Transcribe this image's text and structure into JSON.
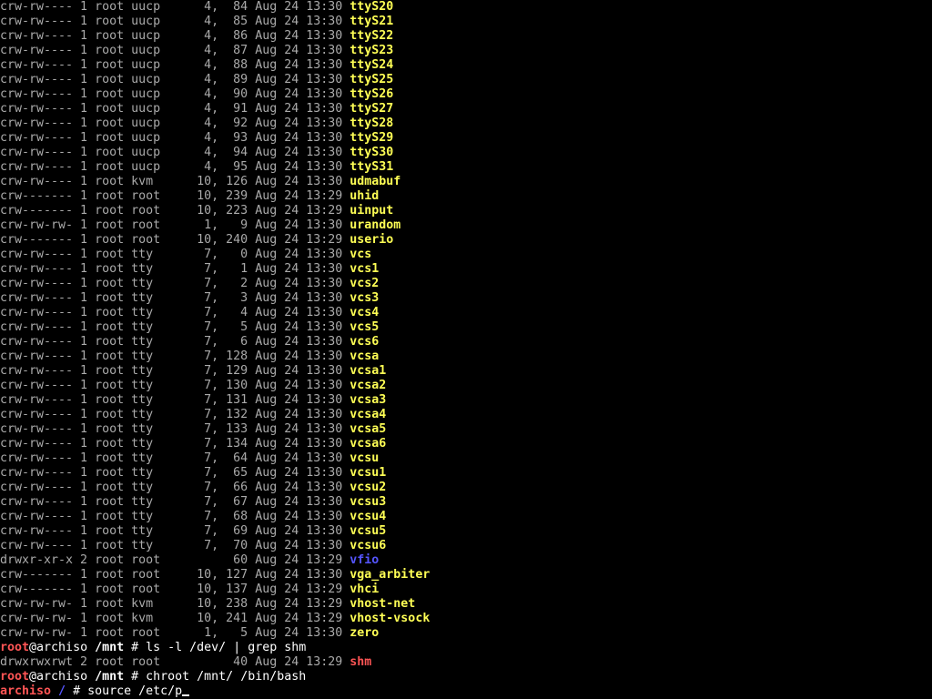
{
  "terminal": {
    "listing": [
      {
        "meta": "crw-rw---- 1 root uucp      4,  84 Aug 24 13:30 ",
        "name": "ttyS20",
        "kind": "dev"
      },
      {
        "meta": "crw-rw---- 1 root uucp      4,  85 Aug 24 13:30 ",
        "name": "ttyS21",
        "kind": "dev"
      },
      {
        "meta": "crw-rw---- 1 root uucp      4,  86 Aug 24 13:30 ",
        "name": "ttyS22",
        "kind": "dev"
      },
      {
        "meta": "crw-rw---- 1 root uucp      4,  87 Aug 24 13:30 ",
        "name": "ttyS23",
        "kind": "dev"
      },
      {
        "meta": "crw-rw---- 1 root uucp      4,  88 Aug 24 13:30 ",
        "name": "ttyS24",
        "kind": "dev"
      },
      {
        "meta": "crw-rw---- 1 root uucp      4,  89 Aug 24 13:30 ",
        "name": "ttyS25",
        "kind": "dev"
      },
      {
        "meta": "crw-rw---- 1 root uucp      4,  90 Aug 24 13:30 ",
        "name": "ttyS26",
        "kind": "dev"
      },
      {
        "meta": "crw-rw---- 1 root uucp      4,  91 Aug 24 13:30 ",
        "name": "ttyS27",
        "kind": "dev"
      },
      {
        "meta": "crw-rw---- 1 root uucp      4,  92 Aug 24 13:30 ",
        "name": "ttyS28",
        "kind": "dev"
      },
      {
        "meta": "crw-rw---- 1 root uucp      4,  93 Aug 24 13:30 ",
        "name": "ttyS29",
        "kind": "dev"
      },
      {
        "meta": "crw-rw---- 1 root uucp      4,  94 Aug 24 13:30 ",
        "name": "ttyS30",
        "kind": "dev"
      },
      {
        "meta": "crw-rw---- 1 root uucp      4,  95 Aug 24 13:30 ",
        "name": "ttyS31",
        "kind": "dev"
      },
      {
        "meta": "crw-rw---- 1 root kvm      10, 126 Aug 24 13:30 ",
        "name": "udmabuf",
        "kind": "dev"
      },
      {
        "meta": "crw------- 1 root root     10, 239 Aug 24 13:29 ",
        "name": "uhid",
        "kind": "dev"
      },
      {
        "meta": "crw------- 1 root root     10, 223 Aug 24 13:29 ",
        "name": "uinput",
        "kind": "dev"
      },
      {
        "meta": "crw-rw-rw- 1 root root      1,   9 Aug 24 13:30 ",
        "name": "urandom",
        "kind": "dev"
      },
      {
        "meta": "crw------- 1 root root     10, 240 Aug 24 13:29 ",
        "name": "userio",
        "kind": "dev"
      },
      {
        "meta": "crw-rw---- 1 root tty       7,   0 Aug 24 13:30 ",
        "name": "vcs",
        "kind": "dev"
      },
      {
        "meta": "crw-rw---- 1 root tty       7,   1 Aug 24 13:30 ",
        "name": "vcs1",
        "kind": "dev"
      },
      {
        "meta": "crw-rw---- 1 root tty       7,   2 Aug 24 13:30 ",
        "name": "vcs2",
        "kind": "dev"
      },
      {
        "meta": "crw-rw---- 1 root tty       7,   3 Aug 24 13:30 ",
        "name": "vcs3",
        "kind": "dev"
      },
      {
        "meta": "crw-rw---- 1 root tty       7,   4 Aug 24 13:30 ",
        "name": "vcs4",
        "kind": "dev"
      },
      {
        "meta": "crw-rw---- 1 root tty       7,   5 Aug 24 13:30 ",
        "name": "vcs5",
        "kind": "dev"
      },
      {
        "meta": "crw-rw---- 1 root tty       7,   6 Aug 24 13:30 ",
        "name": "vcs6",
        "kind": "dev"
      },
      {
        "meta": "crw-rw---- 1 root tty       7, 128 Aug 24 13:30 ",
        "name": "vcsa",
        "kind": "dev"
      },
      {
        "meta": "crw-rw---- 1 root tty       7, 129 Aug 24 13:30 ",
        "name": "vcsa1",
        "kind": "dev"
      },
      {
        "meta": "crw-rw---- 1 root tty       7, 130 Aug 24 13:30 ",
        "name": "vcsa2",
        "kind": "dev"
      },
      {
        "meta": "crw-rw---- 1 root tty       7, 131 Aug 24 13:30 ",
        "name": "vcsa3",
        "kind": "dev"
      },
      {
        "meta": "crw-rw---- 1 root tty       7, 132 Aug 24 13:30 ",
        "name": "vcsa4",
        "kind": "dev"
      },
      {
        "meta": "crw-rw---- 1 root tty       7, 133 Aug 24 13:30 ",
        "name": "vcsa5",
        "kind": "dev"
      },
      {
        "meta": "crw-rw---- 1 root tty       7, 134 Aug 24 13:30 ",
        "name": "vcsa6",
        "kind": "dev"
      },
      {
        "meta": "crw-rw---- 1 root tty       7,  64 Aug 24 13:30 ",
        "name": "vcsu",
        "kind": "dev"
      },
      {
        "meta": "crw-rw---- 1 root tty       7,  65 Aug 24 13:30 ",
        "name": "vcsu1",
        "kind": "dev"
      },
      {
        "meta": "crw-rw---- 1 root tty       7,  66 Aug 24 13:30 ",
        "name": "vcsu2",
        "kind": "dev"
      },
      {
        "meta": "crw-rw---- 1 root tty       7,  67 Aug 24 13:30 ",
        "name": "vcsu3",
        "kind": "dev"
      },
      {
        "meta": "crw-rw---- 1 root tty       7,  68 Aug 24 13:30 ",
        "name": "vcsu4",
        "kind": "dev"
      },
      {
        "meta": "crw-rw---- 1 root tty       7,  69 Aug 24 13:30 ",
        "name": "vcsu5",
        "kind": "dev"
      },
      {
        "meta": "crw-rw---- 1 root tty       7,  70 Aug 24 13:30 ",
        "name": "vcsu6",
        "kind": "dev"
      },
      {
        "meta": "drwxr-xr-x 2 root root          60 Aug 24 13:29 ",
        "name": "vfio",
        "kind": "dir"
      },
      {
        "meta": "crw------- 1 root root     10, 127 Aug 24 13:30 ",
        "name": "vga_arbiter",
        "kind": "dev"
      },
      {
        "meta": "crw------- 1 root root     10, 137 Aug 24 13:29 ",
        "name": "vhci",
        "kind": "dev"
      },
      {
        "meta": "crw-rw-rw- 1 root kvm      10, 238 Aug 24 13:29 ",
        "name": "vhost-net",
        "kind": "dev"
      },
      {
        "meta": "crw-rw-rw- 1 root kvm      10, 241 Aug 24 13:29 ",
        "name": "vhost-vsock",
        "kind": "dev"
      },
      {
        "meta": "crw-rw-rw- 1 root root      1,   5 Aug 24 13:30 ",
        "name": "zero",
        "kind": "dev"
      }
    ],
    "prompt1": {
      "user": "root",
      "host": "@archiso",
      "path": " /mnt",
      "rest": " # ls -l /dev/ | grep shm"
    },
    "shm_line": {
      "meta": "drwxrwxrwt 2 root root          40 Aug 24 13:29 ",
      "name": "shm"
    },
    "prompt2": {
      "user": "root",
      "host": "@archiso",
      "path": " /mnt",
      "rest": " # chroot /mnt/ /bin/bash"
    },
    "prompt3": {
      "host": "archiso",
      "path": " /",
      "rest": " # source /etc/p"
    }
  },
  "colors": {
    "background": "#000000",
    "text": "#aaaaaa",
    "device_name": "#ffff55",
    "directory_name": "#5555ff",
    "sticky_dir_name": "#ff5555",
    "prompt_user": "#ff5555"
  }
}
